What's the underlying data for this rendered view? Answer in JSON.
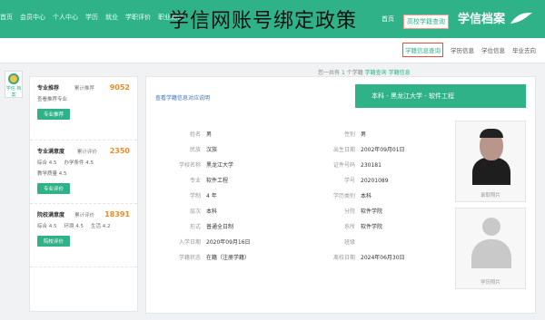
{
  "header": {
    "top_links": [
      "首页",
      "会员中心",
      "个人中心",
      "学历",
      "就业",
      "学职评价",
      "职业测试"
    ],
    "logo": "学信档案",
    "nav": [
      "首页",
      "高校学籍查询"
    ],
    "watermark": "学信网账号绑定政策"
  },
  "subnav": [
    "学籍信息查询",
    "学历信息",
    "学位信息",
    "毕业去向"
  ],
  "sidebar_badge": "学信\n档案",
  "left": {
    "sections": [
      {
        "title": "专业推荐",
        "label": "累计推荐",
        "number": "9052",
        "lines": [
          "查看推荐专业"
        ],
        "btn": "专业推荐"
      },
      {
        "title": "专业满意度",
        "label": "累计评价",
        "number": "2350",
        "lines": [
          "综合 4.5",
          "办学条件 4.5",
          "教学质量 4.5"
        ],
        "btn": "专业评价"
      },
      {
        "title": "院校满意度",
        "label": "累计评价",
        "number": "18391",
        "lines": [
          "综合 4.5",
          "环境 4.5",
          "生活 4.2"
        ],
        "btn": "院校评价"
      }
    ]
  },
  "crumb": {
    "prefix": "您一共有",
    "count": "1",
    "unit": "个学籍",
    "link1": "学籍查询",
    "link2": "学籍信息"
  },
  "main": {
    "hint": "查看学籍信息对应说明",
    "banner": "本科 - 黑龙江大学 - 软件工程",
    "fields_left": [
      [
        "姓名",
        "男"
      ],
      [
        "民族",
        "汉族"
      ],
      [
        "学校名称",
        "黑龙江大学"
      ],
      [
        "专业",
        "软件工程"
      ],
      [
        "学制",
        "4 年"
      ],
      [
        "层次",
        "本科"
      ],
      [
        "形式",
        "普通全日制"
      ],
      [
        "入学日期",
        "2020年09月16日"
      ],
      [
        "学籍状态",
        "在籍（注册学籍）"
      ]
    ],
    "fields_right": [
      [
        "性别",
        "男"
      ],
      [
        "出生日期",
        "2002年09月01日"
      ],
      [
        "证件号码",
        "230181"
      ],
      [
        "学号",
        "20201089"
      ],
      [
        "学历类别",
        "本科"
      ],
      [
        "分院",
        "软件学院"
      ],
      [
        "系所",
        "软件学院"
      ],
      [
        "班级",
        ""
      ],
      [
        "离校日期",
        "2024年06月30日"
      ]
    ],
    "photo1_label": "录取照片",
    "photo2_label": "学历照片"
  }
}
